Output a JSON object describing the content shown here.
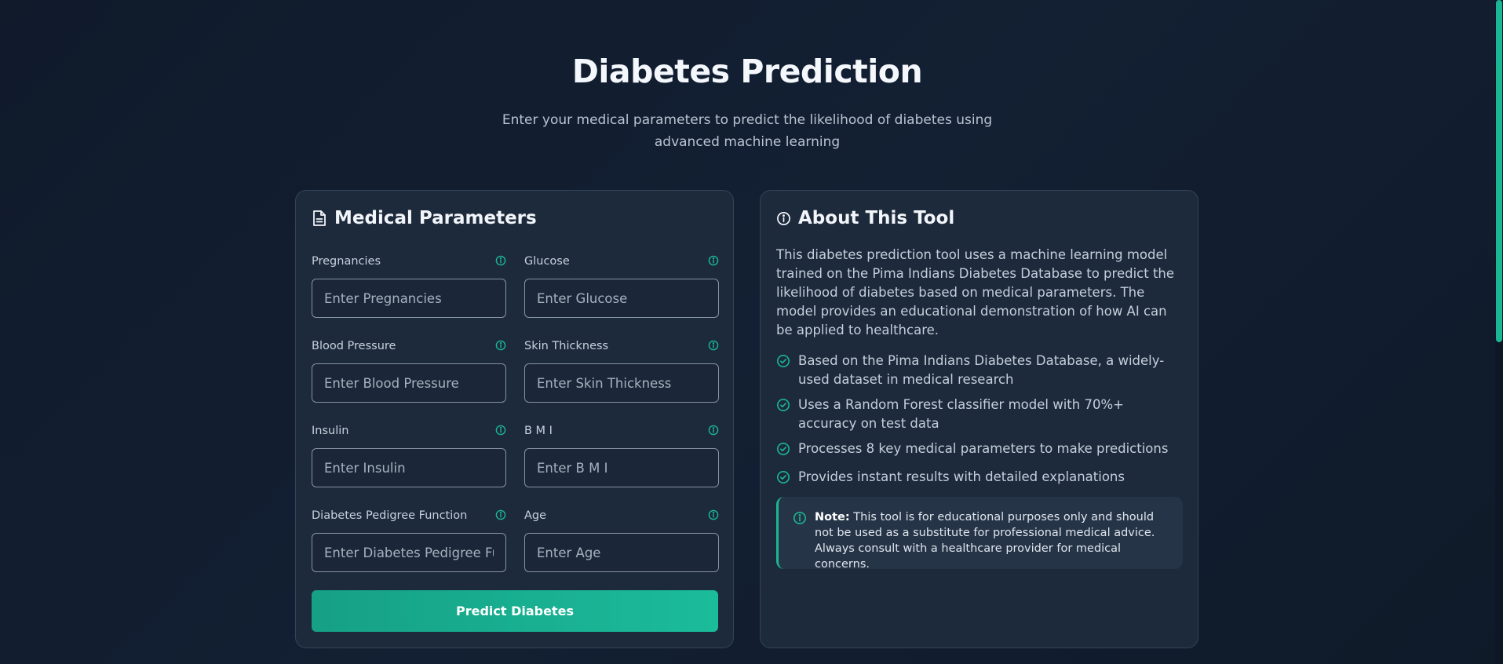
{
  "hero": {
    "title": "Diabetes Prediction",
    "subtitle": "Enter your medical parameters to predict the likelihood of diabetes using advanced machine learning"
  },
  "form": {
    "title": "Medical Parameters",
    "title_icon": "document-icon",
    "info_icon": "info-icon",
    "fields": [
      {
        "label": "Pregnancies",
        "placeholder": "Enter Pregnancies",
        "value": ""
      },
      {
        "label": "Glucose",
        "placeholder": "Enter Glucose",
        "value": ""
      },
      {
        "label": "Blood Pressure",
        "placeholder": "Enter Blood Pressure",
        "value": ""
      },
      {
        "label": "Skin Thickness",
        "placeholder": "Enter Skin Thickness",
        "value": ""
      },
      {
        "label": "Insulin",
        "placeholder": "Enter Insulin",
        "value": ""
      },
      {
        "label": "B M I",
        "placeholder": "Enter B M I",
        "value": ""
      },
      {
        "label": "Diabetes Pedigree Function",
        "placeholder": "Enter Diabetes Pedigree Function",
        "value": ""
      },
      {
        "label": "Age",
        "placeholder": "Enter Age",
        "value": ""
      }
    ],
    "submit_label": "Predict Diabetes"
  },
  "about": {
    "title": "About This Tool",
    "title_icon": "info-icon",
    "description": "This diabetes prediction tool uses a machine learning model trained on the Pima Indians Diabetes Database to predict the likelihood of diabetes based on medical parameters. The model provides an educational demonstration of how AI can be applied to healthcare.",
    "features": [
      "Based on the Pima Indians Diabetes Database, a widely-used dataset in medical research",
      "Uses a Random Forest classifier model with 70%+ accuracy on test data",
      "Processes 8 key medical parameters to make predictions",
      "Provides instant results with detailed explanations"
    ],
    "feature_icon": "check-circle-icon",
    "note_label": "Note:",
    "note_text": " This tool is for educational purposes only and should not be used as a substitute for professional medical advice. Always consult with a healthcare provider for medical concerns."
  },
  "colors": {
    "accent": "#1bb694",
    "background": "#111c2d",
    "card": "#1d2a3c"
  }
}
